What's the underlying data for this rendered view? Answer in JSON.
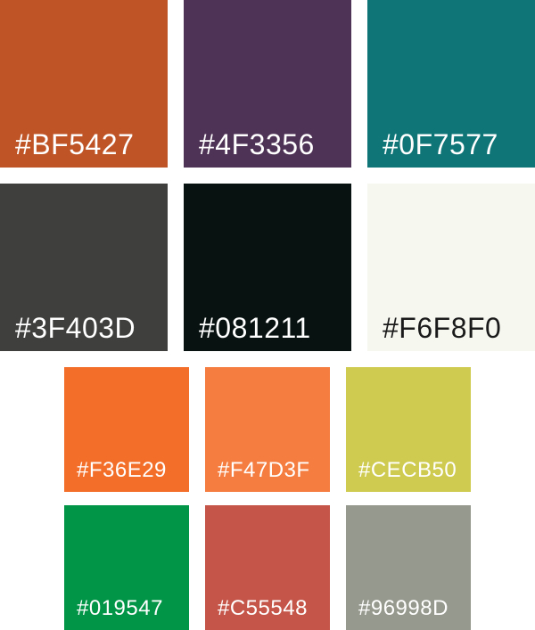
{
  "swatches": [
    {
      "label": "#BF5427",
      "color": "#BF5427",
      "text_color": "#FFFFFF"
    },
    {
      "label": "#4F3356",
      "color": "#4F3356",
      "text_color": "#FFFFFF"
    },
    {
      "label": "#0F7577",
      "color": "#0F7577",
      "text_color": "#FFFFFF"
    },
    {
      "label": "#3F403D",
      "color": "#3F403D",
      "text_color": "#FFFFFF"
    },
    {
      "label": "#081211",
      "color": "#081211",
      "text_color": "#FFFFFF"
    },
    {
      "label": "#F6F8F0",
      "color": "#F6F8F0",
      "text_color": "#1A1A1A"
    },
    {
      "label": "#F36E29",
      "color": "#F36E29",
      "text_color": "#FFFFFF"
    },
    {
      "label": "#F47D3F",
      "color": "#F47D3F",
      "text_color": "#FFFFFF"
    },
    {
      "label": "#CECB50",
      "color": "#CECB50",
      "text_color": "#FFFFFF"
    },
    {
      "label": "#019547",
      "color": "#019547",
      "text_color": "#FFFFFF"
    },
    {
      "label": "#C55548",
      "color": "#C55548",
      "text_color": "#FFFFFF"
    },
    {
      "label": "#96998D",
      "color": "#96998D",
      "text_color": "#FFFFFF"
    }
  ]
}
